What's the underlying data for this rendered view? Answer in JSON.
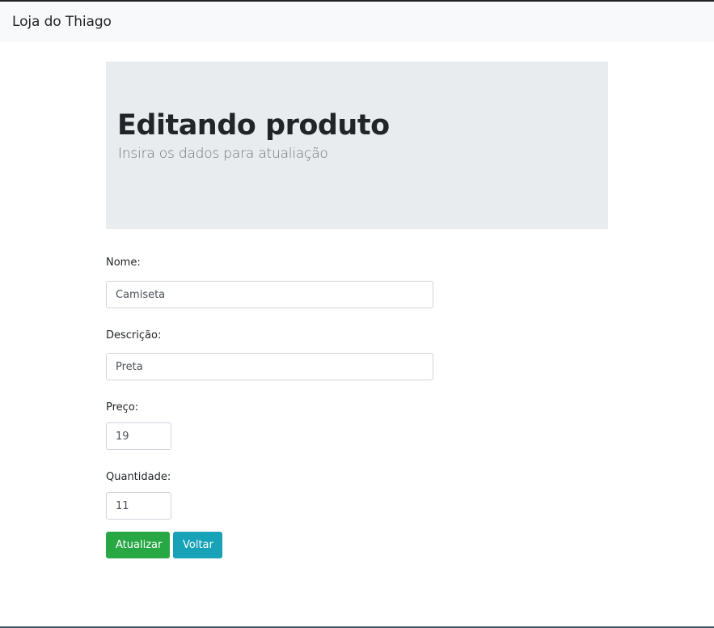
{
  "navbar": {
    "brand": "Loja do Thiago"
  },
  "header": {
    "title": "Editando produto",
    "subtitle": "Insira os dados para atualiação"
  },
  "form": {
    "nome": {
      "label": "Nome:",
      "value": "Camiseta"
    },
    "descricao": {
      "label": "Descrição:",
      "value": "Preta"
    },
    "preco": {
      "label": "Preço:",
      "value": "19"
    },
    "quantidade": {
      "label": "Quantidade:",
      "value": "11"
    }
  },
  "buttons": {
    "update_label": "Atualizar",
    "back_label": "Voltar"
  },
  "colors": {
    "success": "#28a745",
    "info": "#17a2b8",
    "jumbotron_bg": "#e9ecef",
    "navbar_bg": "#f8f9fa"
  }
}
